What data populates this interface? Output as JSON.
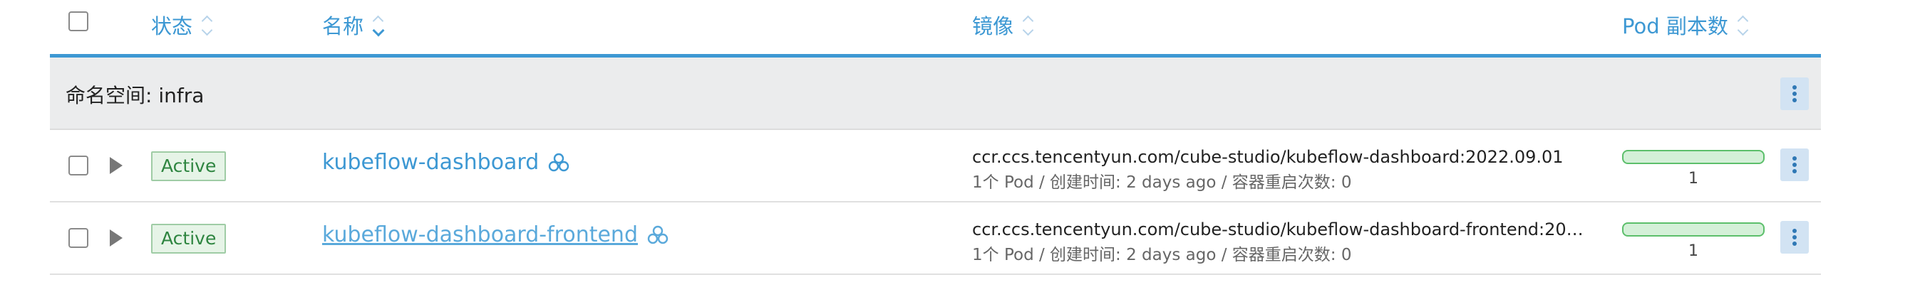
{
  "header": {
    "state": "状态",
    "name": "名称",
    "image": "镜像",
    "pods": "Pod 副本数"
  },
  "group": {
    "label": "命名空间: infra"
  },
  "rows": [
    {
      "status": "Active",
      "name": "kubeflow-dashboard",
      "image": "ccr.ccs.tencentyun.com/cube-studio/kubeflow-dashboard:2022.09.01",
      "meta": "1个 Pod / 创建时间: 2 days ago / 容器重启次数: 0",
      "pod_count": "1",
      "pod_ready_fraction": 1.0
    },
    {
      "status": "Active",
      "name": "kubeflow-dashboard-frontend",
      "image": "ccr.ccs.tencentyun.com/cube-studio/kubeflow-dashboard-frontend:2022....",
      "meta": "1个 Pod / 创建时间: 2 days ago / 容器重启次数: 0",
      "pod_count": "1",
      "pod_ready_fraction": 1.0
    }
  ],
  "colors": {
    "accent": "#3d98d3",
    "active_badge_bg": "#e6f4e7",
    "active_badge_text": "#2e8540",
    "progress_border": "#5cbf6b"
  },
  "icons": {
    "sort": "sort-icon",
    "cluster": "cluster-icon",
    "expand": "expand-triangle-icon",
    "kebab": "kebab-menu-icon"
  }
}
